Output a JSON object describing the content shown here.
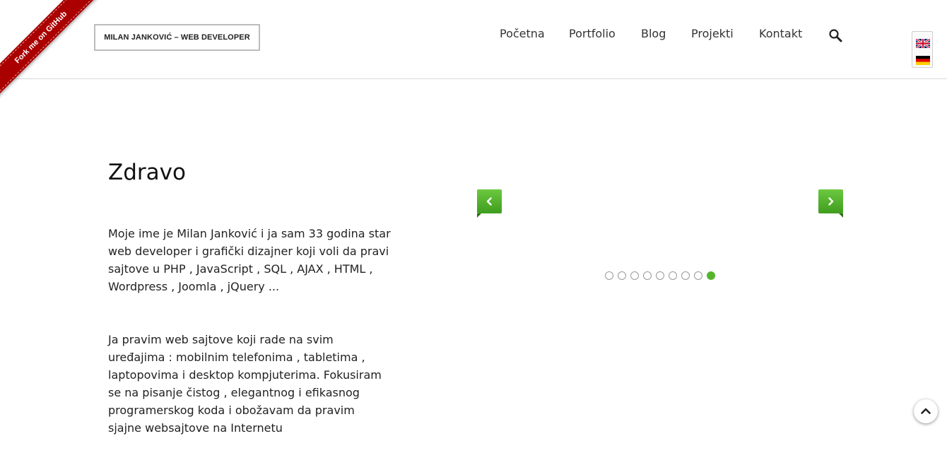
{
  "ribbon": {
    "label": "Fork me on GitHub"
  },
  "header": {
    "logo_text": "MILAN JANKOVIĆ – WEB DEVELOPER",
    "nav": [
      {
        "label": "Početna"
      },
      {
        "label": "Portfolio"
      },
      {
        "label": "Blog"
      },
      {
        "label": "Projekti"
      },
      {
        "label": "Kontakt"
      }
    ],
    "search_icon": "search-icon",
    "languages": [
      {
        "icon": "uk-flag-icon"
      },
      {
        "icon": "germany-flag-icon"
      }
    ]
  },
  "intro": {
    "title": "Zdravo",
    "paragraph1": "Moje ime je Milan Janković i ja sam 33 godina star web developer i grafički dizajner koji voli da pravi sajtove u PHP , JavaScript , SQL , AJAX , HTML , Wordpress , Joomla , jQuery ...",
    "paragraph2": "Ja pravim web sajtove koji rade na svim uređajima : mobilnim telefonima , tabletima , laptopovima i desktop kompjuterima. Fokusiram se na pisanje čistog , elegantnog i efikasnog programerskog koda i obožavam da pravim sjajne websajtove na Internetu"
  },
  "slider": {
    "slide_count": 9,
    "active_slide": 9,
    "prev_icon": "chevron-left-icon",
    "next_icon": "chevron-right-icon",
    "accent_color": "#56b42b"
  },
  "back_to_top": {
    "icon": "chevron-up-icon"
  },
  "colors": {
    "ribbon": "#aa0000",
    "accent": "#56b42b"
  }
}
